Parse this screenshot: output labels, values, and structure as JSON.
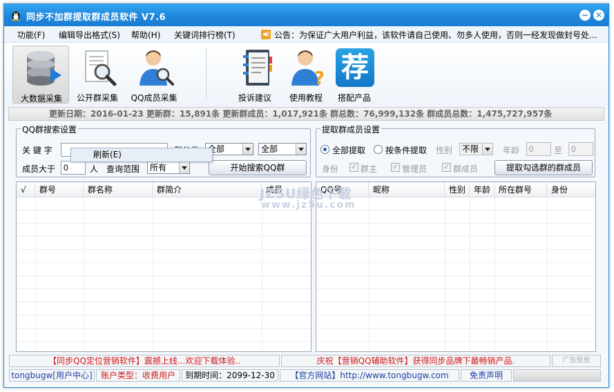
{
  "app": {
    "title": "同步不加群提取群成员软件    V7.6"
  },
  "menu": [
    "功能(F)",
    "编辑导出格式(S)",
    "帮助(H)",
    "关键词排行榜(T)"
  ],
  "notice": "公告：为保证广大用户利益，该软件请自己使用、勿多人使用，否则一经发现做封号处...",
  "toolbar": [
    "大数据采集",
    "公开群采集",
    "QQ成员采集",
    "投诉建议",
    "使用教程",
    "搭配产品"
  ],
  "toolbar_icons": [
    "database-icon",
    "document-search-icon",
    "user-search-icon",
    "notebook-icon",
    "user-help-icon",
    "brand-icon"
  ],
  "brand_glyph": "荐",
  "stats": "更新日期：2016-01-23  更新群：15,891条  更新群成员：1,017,921条  群总数：76,999,132条  群成员总数：1,475,727,957条",
  "search": {
    "legend": "QQ群搜索设置",
    "keyword_label": "关 键 字",
    "keyword_value": "",
    "category_label": "群分类",
    "category1": "全部",
    "category2": "全部",
    "members_label": "成员大于",
    "members_value": "0",
    "members_unit": "人",
    "scope_label": "查询范围",
    "scope_value": "所有",
    "search_button": "开始搜索QQ群"
  },
  "context_menu": {
    "refresh": "刷新(E)"
  },
  "extract": {
    "legend": "提取群成员设置",
    "all_label": "全部提取",
    "cond_label": "按条件提取",
    "gender_label": "性别",
    "gender_value": "不限",
    "age_label": "年龄",
    "age_from": "0",
    "age_to_label": "至",
    "age_to": "0",
    "role_label": "身份",
    "owner_label": "群主",
    "admin_label": "管理员",
    "member_label": "群成员",
    "extract_button": "提取勾选群的群成员"
  },
  "left_table": {
    "columns": [
      "√",
      "群号",
      "群名称",
      "群简介",
      "成员"
    ]
  },
  "right_table": {
    "columns": [
      "QQ号",
      "昵称",
      "性别",
      "年龄",
      "所在群号",
      "身份"
    ]
  },
  "watermark": {
    "line1": "JZ5U绿色下载",
    "line2": "www.jz5u.com"
  },
  "promo": {
    "left": "【同步QQ定位营销软件】震撼上线...欢迎下载体验..",
    "right": "庆祝【营销QQ辅助软件】获得同步品牌下最畅销产品.",
    "ad": "广告投放"
  },
  "statusbar": {
    "user": "tongbugw[用户中心]",
    "account": "账户类型：收费用户",
    "expire": "到期时间：2099-12-30",
    "site": "【官方网站】http://www.tongbugw.com",
    "disclaimer": "免责声明"
  },
  "colors": {
    "titlebar": "#1e86dc",
    "accent_red": "#d01818",
    "link_blue": "#1a3fa0"
  }
}
